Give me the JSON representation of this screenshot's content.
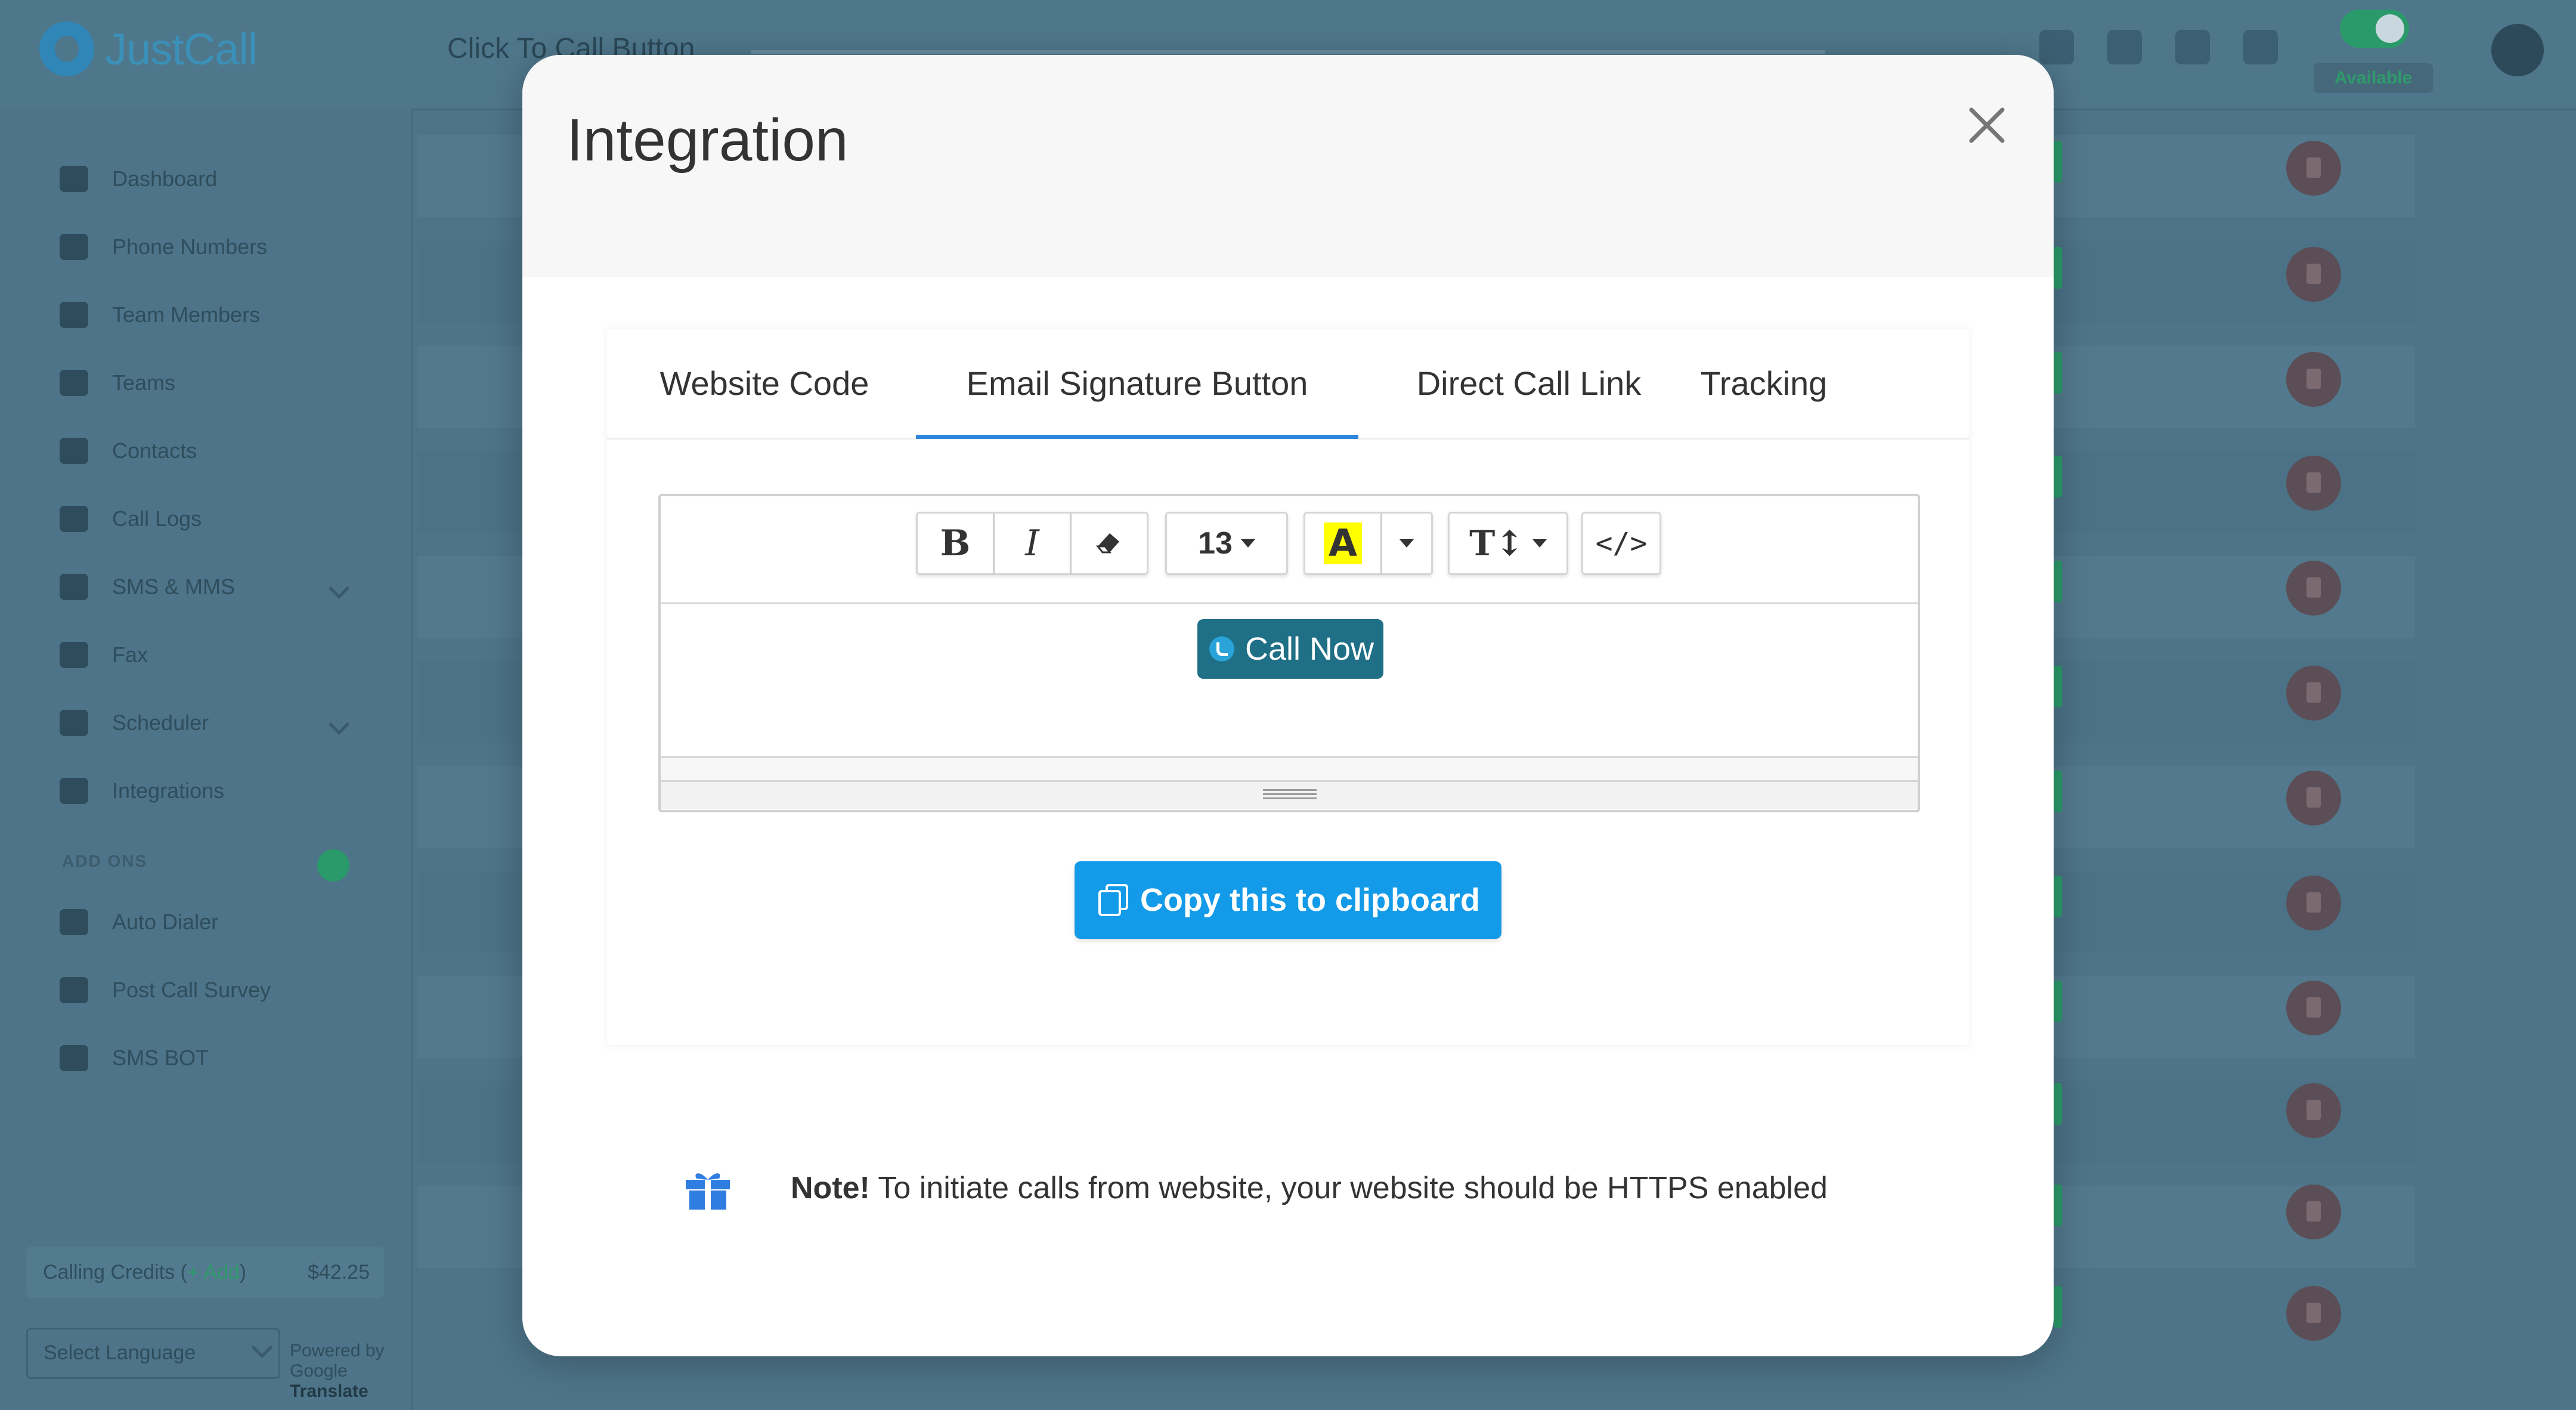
{
  "app": {
    "logo_text": "JustCall",
    "page_title": "Click To Call Button",
    "status_label": "Available"
  },
  "sidebar": {
    "items": [
      {
        "label": "Dashboard",
        "icon": "home-icon"
      },
      {
        "label": "Phone Numbers",
        "icon": "phone-icon"
      },
      {
        "label": "Team Members",
        "icon": "users-icon"
      },
      {
        "label": "Teams",
        "icon": "teams-icon"
      },
      {
        "label": "Contacts",
        "icon": "contacts-icon"
      },
      {
        "label": "Call Logs",
        "icon": "call-logs-icon"
      },
      {
        "label": "SMS & MMS",
        "icon": "sms-icon"
      },
      {
        "label": "Fax",
        "icon": "fax-icon"
      },
      {
        "label": "Scheduler",
        "icon": "scheduler-icon"
      },
      {
        "label": "Integrations",
        "icon": "integrations-icon"
      }
    ],
    "addons_heading": "ADD ONS",
    "addons": [
      {
        "label": "Auto Dialer"
      },
      {
        "label": "Post Call Survey"
      },
      {
        "label": "SMS BOT"
      }
    ],
    "credits_label": "Calling Credits (",
    "credits_add": "+ Add",
    "credits_close": ")",
    "credits_value": "$42.25",
    "language_select": "Select Language",
    "powered_by": "Powered by",
    "google": "Google",
    "translate": "Translate"
  },
  "modal": {
    "title": "Integration",
    "close_label": "×",
    "tabs": [
      {
        "label": "Website Code"
      },
      {
        "label": "Email Signature Button",
        "active": true
      },
      {
        "label": "Direct Call Link"
      },
      {
        "label": "Tracking"
      }
    ],
    "toolbar": {
      "bold": "B",
      "italic": "I",
      "font_size": "13",
      "highlight": "A",
      "text_height": "T↕",
      "code": "</>"
    },
    "call_now_label": "Call Now",
    "copy_button_label": "Copy this to clipboard",
    "note_bold": "Note!",
    "note_text": " To initiate calls from website, your website should be HTTPS enabled"
  },
  "colors": {
    "accent": "#2f86de",
    "copy_button": "#139ae8",
    "call_now": "#1f6f86",
    "highlight": "#ffff00",
    "overlay": "#4d7488"
  }
}
